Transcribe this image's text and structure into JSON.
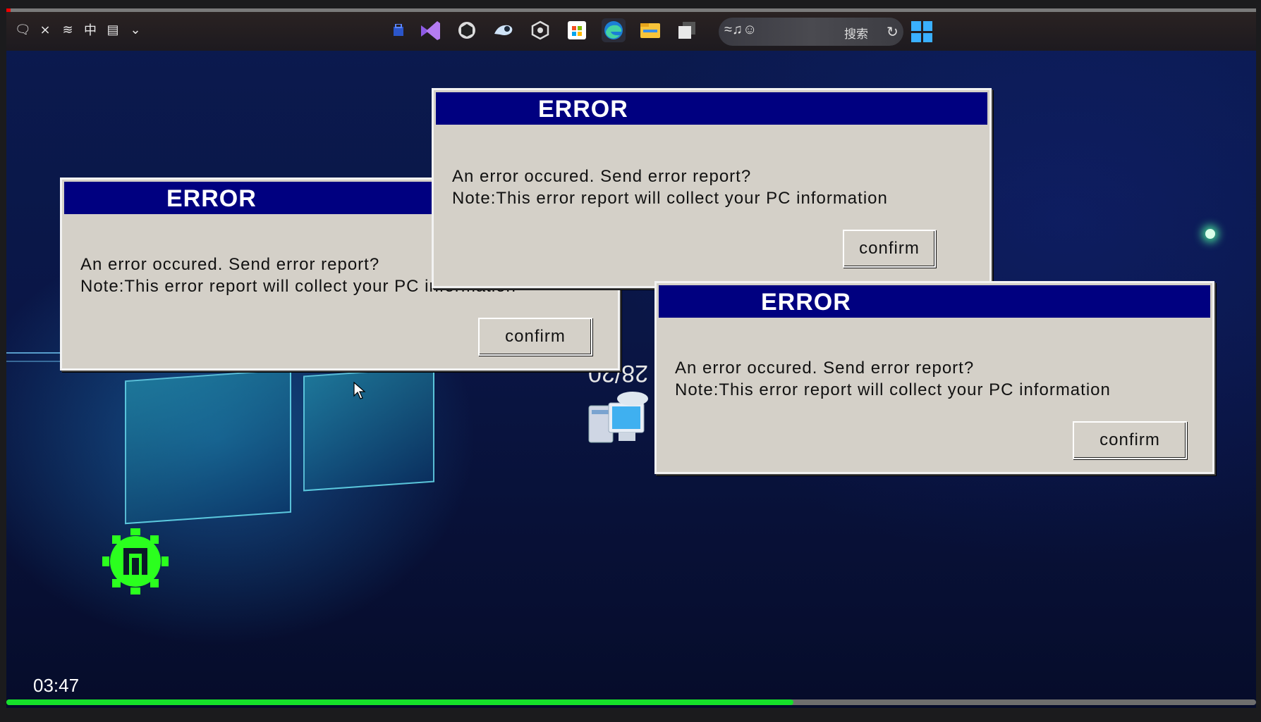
{
  "taskbar": {
    "tray_left": [
      "🗨",
      "⨯",
      "≋",
      "中",
      "▤",
      "⌄"
    ],
    "apps": [
      "store-icon",
      "visual-studio-icon",
      "unity-icon",
      "steam-icon",
      "cube-icon",
      "microsoft-store-icon",
      "edge-icon",
      "file-explorer-icon",
      "windows-icon"
    ],
    "search_text": "搜索",
    "windows_logo_color": "#3ab0ff"
  },
  "desktop": {
    "mirrored_text": "28/20",
    "colors": {
      "accent_green": "#16e02a",
      "titlebar": "#000080",
      "dialog_bg": "#d4d0c8"
    }
  },
  "dialogs": [
    {
      "title": "ERROR",
      "line1": "An error occured. Send error report?",
      "line2": "Note:This error report will collect your PC information",
      "button": "confirm"
    },
    {
      "title": "ERROR",
      "line1": "An error occured. Send error report?",
      "line2": "Note:This error report will collect your PC information",
      "button": "confirm"
    },
    {
      "title": "ERROR",
      "line1": "An error occured. Send error report?",
      "line2": "Note:This error report will collect your PC information",
      "button": "confirm"
    }
  ],
  "hud": {
    "timer": "03:47",
    "progress": 0.63
  }
}
